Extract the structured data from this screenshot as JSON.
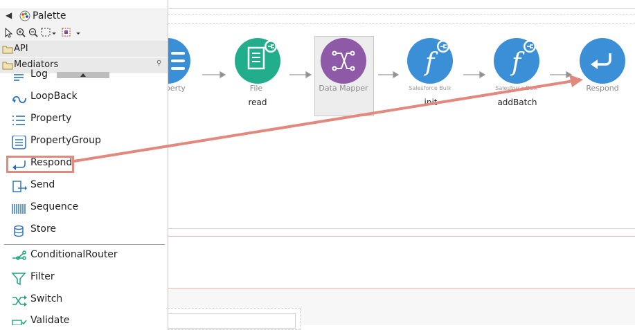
{
  "palette": {
    "title": "Palette",
    "drawers": {
      "api": "API",
      "mediators": "Mediators"
    },
    "items": [
      {
        "label": "Log",
        "icon": "log-icon"
      },
      {
        "label": "LoopBack",
        "icon": "loopback-icon"
      },
      {
        "label": "Property",
        "icon": "property-icon"
      },
      {
        "label": "PropertyGroup",
        "icon": "property-group-icon"
      },
      {
        "label": "Respond",
        "icon": "respond-icon"
      },
      {
        "label": "Send",
        "icon": "send-icon"
      },
      {
        "label": "Sequence",
        "icon": "sequence-icon"
      },
      {
        "label": "Store",
        "icon": "store-icon"
      }
    ],
    "filter_items": [
      {
        "label": "ConditionalRouter",
        "icon": "conditional-router-icon"
      },
      {
        "label": "Filter",
        "icon": "filter-icon"
      },
      {
        "label": "Switch",
        "icon": "switch-icon"
      },
      {
        "label": "Validate",
        "icon": "validate-icon"
      }
    ]
  },
  "canvas": {
    "nodes": [
      {
        "type": "operty",
        "name": "",
        "icon": "property-icon",
        "color": "#3a8fd6"
      },
      {
        "type": "File",
        "name": "read",
        "icon": "file-icon",
        "color": "#22ad8c"
      },
      {
        "type": "Data Mapper",
        "name": "",
        "icon": "data-mapper-icon",
        "color": "#8e5aa8"
      },
      {
        "type": "Salesforce Bulk",
        "name": "init",
        "icon": "function-icon",
        "color": "#3a8fd6"
      },
      {
        "type": "Salesforce Bulk",
        "name": "addBatch",
        "icon": "function-icon",
        "color": "#3a8fd6"
      },
      {
        "type": "Respond",
        "name": "",
        "icon": "respond-icon",
        "color": "#3a8fd6"
      }
    ]
  },
  "colors": {
    "highlight": "#e2897d",
    "blue": "#3a8fd6",
    "green": "#22ad8c",
    "purple": "#8e5aa8"
  }
}
